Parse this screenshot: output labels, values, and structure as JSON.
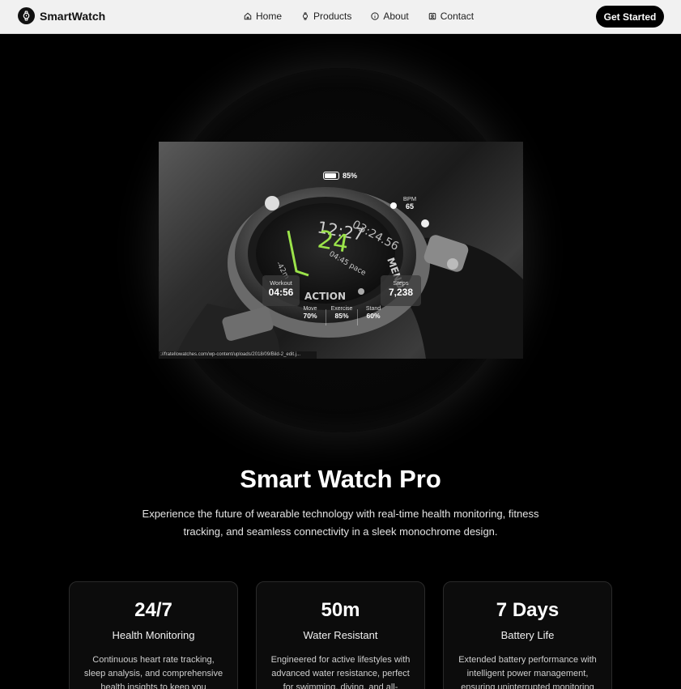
{
  "nav": {
    "brand": "SmartWatch",
    "links": [
      {
        "label": "Home",
        "icon": "home-icon"
      },
      {
        "label": "Products",
        "icon": "watch-icon"
      },
      {
        "label": "About",
        "icon": "info-icon"
      },
      {
        "label": "Contact",
        "icon": "contact-icon"
      }
    ],
    "cta": "Get Started"
  },
  "hero": {
    "image_url_caption": "://fratellowatches.com/wp-content/uploads/2018/09/Bild-2_edit.j...",
    "battery": {
      "value": "85%",
      "level": 0.85
    },
    "bpm": {
      "label": "BPM",
      "value": "65"
    },
    "workout": {
      "label": "Workout",
      "value": "04:56"
    },
    "steps": {
      "label": "Steps",
      "value": "7,238"
    },
    "rings": [
      {
        "label": "Move",
        "value": "70%"
      },
      {
        "label": "Exercise",
        "value": "85%"
      },
      {
        "label": "Stand",
        "value": "60%"
      }
    ]
  },
  "title": "Smart Watch Pro",
  "subtitle": "Experience the future of wearable technology with real-time health monitoring, fitness tracking, and seamless connectivity in a sleek monochrome design.",
  "features": [
    {
      "stat": "24/7",
      "title": "Health Monitoring",
      "desc": "Continuous heart rate tracking, sleep analysis, and comprehensive health insights to keep you"
    },
    {
      "stat": "50m",
      "title": "Water Resistant",
      "desc": "Engineered for active lifestyles with advanced water resistance, perfect for swimming, diving, and all-"
    },
    {
      "stat": "7 Days",
      "title": "Battery Life",
      "desc": "Extended battery performance with intelligent power management, ensuring uninterrupted monitoring"
    }
  ],
  "colors": {
    "nav_bg": "#f1f1f1",
    "accent": "#000000",
    "display_green": "#9be34a"
  }
}
